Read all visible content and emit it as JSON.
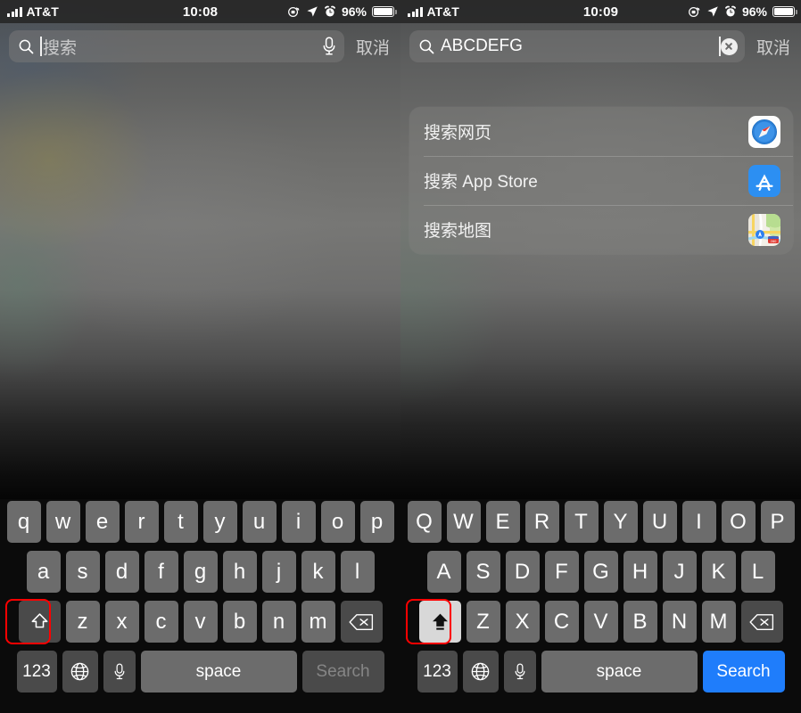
{
  "panels": [
    {
      "id": "left",
      "status_bar": {
        "carrier": "AT&T",
        "time": "10:08",
        "battery_percent": "96%",
        "icons": [
          "signal-bars-icon",
          "rotation-lock-icon",
          "location-arrow-icon",
          "alarm-clock-icon",
          "battery-icon"
        ]
      },
      "search": {
        "value": "",
        "placeholder": "搜索",
        "cancel_label": "取消",
        "has_caret": true,
        "trailing_control": "microphone-icon"
      },
      "suggestions": [],
      "keyboard": {
        "shift_state": "unshifted",
        "row1": [
          "q",
          "w",
          "e",
          "r",
          "t",
          "y",
          "u",
          "i",
          "o",
          "p"
        ],
        "row2": [
          "a",
          "s",
          "d",
          "f",
          "g",
          "h",
          "j",
          "k",
          "l"
        ],
        "row3": [
          "z",
          "x",
          "c",
          "v",
          "b",
          "n",
          "m"
        ],
        "numbers_label": "123",
        "space_label": "space",
        "action_label": "Search",
        "action_enabled": false,
        "shift_highlighted": true
      }
    },
    {
      "id": "right",
      "status_bar": {
        "carrier": "AT&T",
        "time": "10:09",
        "battery_percent": "96%",
        "icons": [
          "signal-bars-icon",
          "rotation-lock-icon",
          "location-arrow-icon",
          "alarm-clock-icon",
          "battery-icon"
        ]
      },
      "search": {
        "value": "ABCDEFG",
        "placeholder": "搜索",
        "cancel_label": "取消",
        "has_caret": true,
        "trailing_control": "clear-icon"
      },
      "suggestions": [
        {
          "label": "搜索网页",
          "icon": "safari-icon"
        },
        {
          "label": "搜索 App Store",
          "icon": "app-store-icon"
        },
        {
          "label": "搜索地图",
          "icon": "maps-icon"
        }
      ],
      "keyboard": {
        "shift_state": "shifted",
        "row1": [
          "Q",
          "W",
          "E",
          "R",
          "T",
          "Y",
          "U",
          "I",
          "O",
          "P"
        ],
        "row2": [
          "A",
          "S",
          "D",
          "F",
          "G",
          "H",
          "J",
          "K",
          "L"
        ],
        "row3": [
          "Z",
          "X",
          "C",
          "V",
          "B",
          "N",
          "M"
        ],
        "numbers_label": "123",
        "space_label": "space",
        "action_label": "Search",
        "action_enabled": true,
        "shift_highlighted": true
      }
    }
  ],
  "colors": {
    "accent_blue": "#1f7dfb",
    "highlight_red": "#ff0000",
    "key_light": "#6c6c6c",
    "key_dark": "#4a4a4a",
    "key_active": "#d8d8d8",
    "keyboard_bg": "#0b0b0b"
  }
}
